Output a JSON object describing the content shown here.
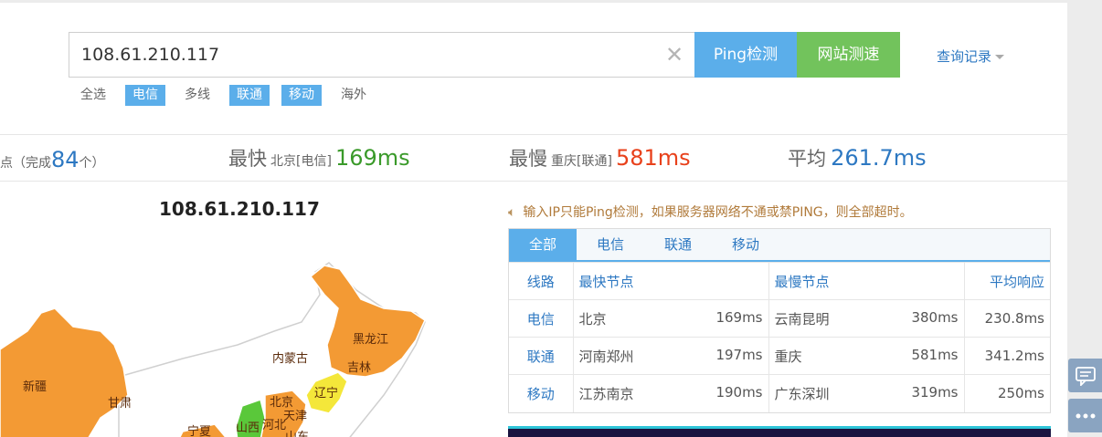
{
  "search": {
    "value": "108.61.210.117",
    "ping_button": "Ping检测",
    "speed_button": "网站测速",
    "history_label": "查询记录"
  },
  "filters": [
    {
      "label": "全选",
      "active": false
    },
    {
      "label": "电信",
      "active": true
    },
    {
      "label": "多线",
      "active": false
    },
    {
      "label": "联通",
      "active": true
    },
    {
      "label": "移动",
      "active": true
    },
    {
      "label": "海外",
      "active": false
    }
  ],
  "stats": {
    "count_prefix": "测点（完成",
    "count_value": "84",
    "count_suffix": "个）",
    "fastest_label": "最快",
    "fastest_node": "北京[电信]",
    "fastest_value": "169ms",
    "slowest_label": "最慢",
    "slowest_node": "重庆[联通]",
    "slowest_value": "581ms",
    "average_label": "平均",
    "average_value": "261.7ms"
  },
  "map": {
    "title": "108.61.210.117",
    "regions": [
      "新疆",
      "甘肃",
      "宁夏",
      "内蒙古",
      "黑龙江",
      "吉林",
      "辽宁",
      "北京",
      "天津",
      "山西",
      "河北",
      "山东"
    ]
  },
  "notice": "输入IP只能Ping检测，如果服务器网络不通或禁PING，则全部超时。",
  "tabs": [
    "全部",
    "电信",
    "联通",
    "移动"
  ],
  "table": {
    "headers": {
      "line": "线路",
      "fastest": "最快节点",
      "slowest": "最慢节点",
      "average": "平均响应"
    },
    "rows": [
      {
        "line": "电信",
        "fast_node": "北京",
        "fast_ms": "169ms",
        "slow_node": "云南昆明",
        "slow_ms": "380ms",
        "avg": "230.8ms"
      },
      {
        "line": "联通",
        "fast_node": "河南郑州",
        "fast_ms": "197ms",
        "slow_node": "重庆",
        "slow_ms": "581ms",
        "avg": "341.2ms"
      },
      {
        "line": "移动",
        "fast_node": "江苏南京",
        "fast_ms": "190ms",
        "slow_node": "广东深圳",
        "slow_ms": "319ms",
        "avg": "250ms"
      }
    ]
  },
  "colors": {
    "accent_blue": "#5baeea",
    "accent_green": "#72c35c",
    "map_orange": "#f39a34",
    "map_yellow": "#f4e73a",
    "map_green": "#5ac83a"
  },
  "icons": [
    "clear-icon",
    "caret-down-icon",
    "speaker-icon",
    "feedback-icon",
    "more-icon"
  ]
}
